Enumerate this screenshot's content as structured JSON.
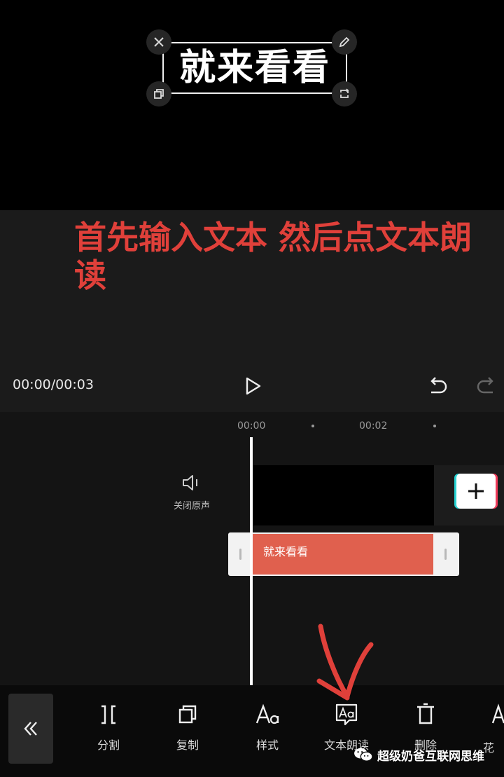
{
  "preview": {
    "subtitle": "就来看看",
    "corner_icons": [
      "close-icon",
      "edit-icon",
      "copy-icon",
      "rotate-icon"
    ]
  },
  "annotation": {
    "instruction": "首先输入文本 然后点文本朗读",
    "arrow_color": "#e0403a"
  },
  "player": {
    "time": "00:00/00:03",
    "icons": [
      "play-icon",
      "undo-icon",
      "redo-icon"
    ]
  },
  "timeline": {
    "ruler": [
      "00:00",
      "00:02"
    ],
    "mute_label": "关闭原声",
    "text_clip_label": "就来看看",
    "text_clip_color": "#e0604e"
  },
  "toolbar": {
    "tools": [
      {
        "label": "分割",
        "icon": "split-icon"
      },
      {
        "label": "复制",
        "icon": "copy-icon"
      },
      {
        "label": "样式",
        "icon": "style-icon"
      },
      {
        "label": "文本朗读",
        "icon": "text-to-speech-icon"
      },
      {
        "label": "删除",
        "icon": "delete-icon"
      },
      {
        "label": "花",
        "icon": "fancy-text-icon"
      }
    ]
  },
  "watermark": {
    "text": "超级奶爸互联网思维",
    "icon": "wechat-icon"
  }
}
